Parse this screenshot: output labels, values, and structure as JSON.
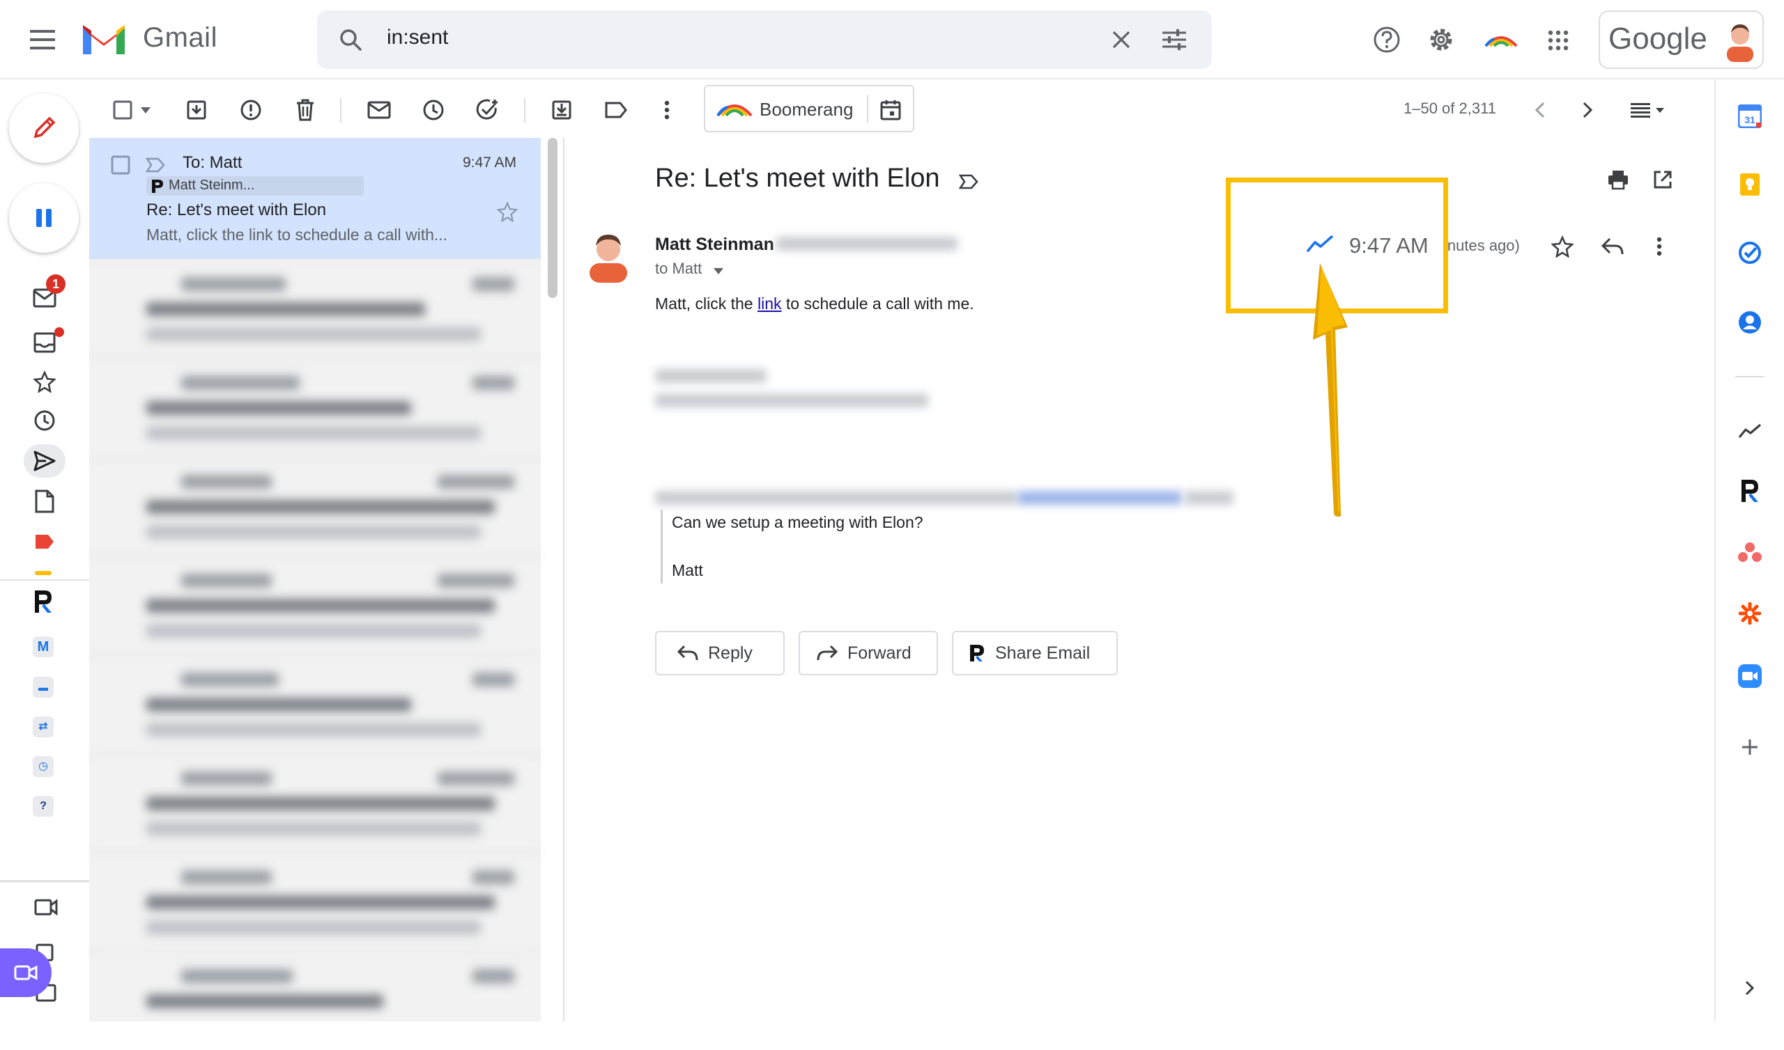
{
  "header": {
    "brand": "Gmail",
    "search_query": "in:sent",
    "google_label": "Google"
  },
  "left_rail": {
    "inbox_badge": "1"
  },
  "toolbar": {
    "boomerang_label": "Boomerang",
    "pager": "1–50 of 2,311"
  },
  "list": {
    "selected": {
      "to": "To: Matt",
      "time": "9:47 AM",
      "chip": "Matt Steinm...",
      "subject": "Re: Let's meet with Elon",
      "snippet": "Matt, click the link to schedule a call with..."
    }
  },
  "message": {
    "subject": "Re: Let's meet with Elon",
    "sender": "Matt Steinman",
    "to": "to Matt",
    "body_before": "Matt, click the ",
    "link_text": "link",
    "body_after": " to schedule a call with me.",
    "time": "9:47 AM",
    "relative_time": "inutes ago)",
    "quote_line1": "Can we setup a meeting with Elon?",
    "quote_line2": "Matt"
  },
  "actions": {
    "reply": "Reply",
    "forward": "Forward",
    "share": "Share Email"
  },
  "colors": {
    "accent_blue": "#1a73e8",
    "callout_yellow": "#fbbc04",
    "selected_row": "#d3e3fd",
    "meet_purple": "#7b61ff"
  }
}
